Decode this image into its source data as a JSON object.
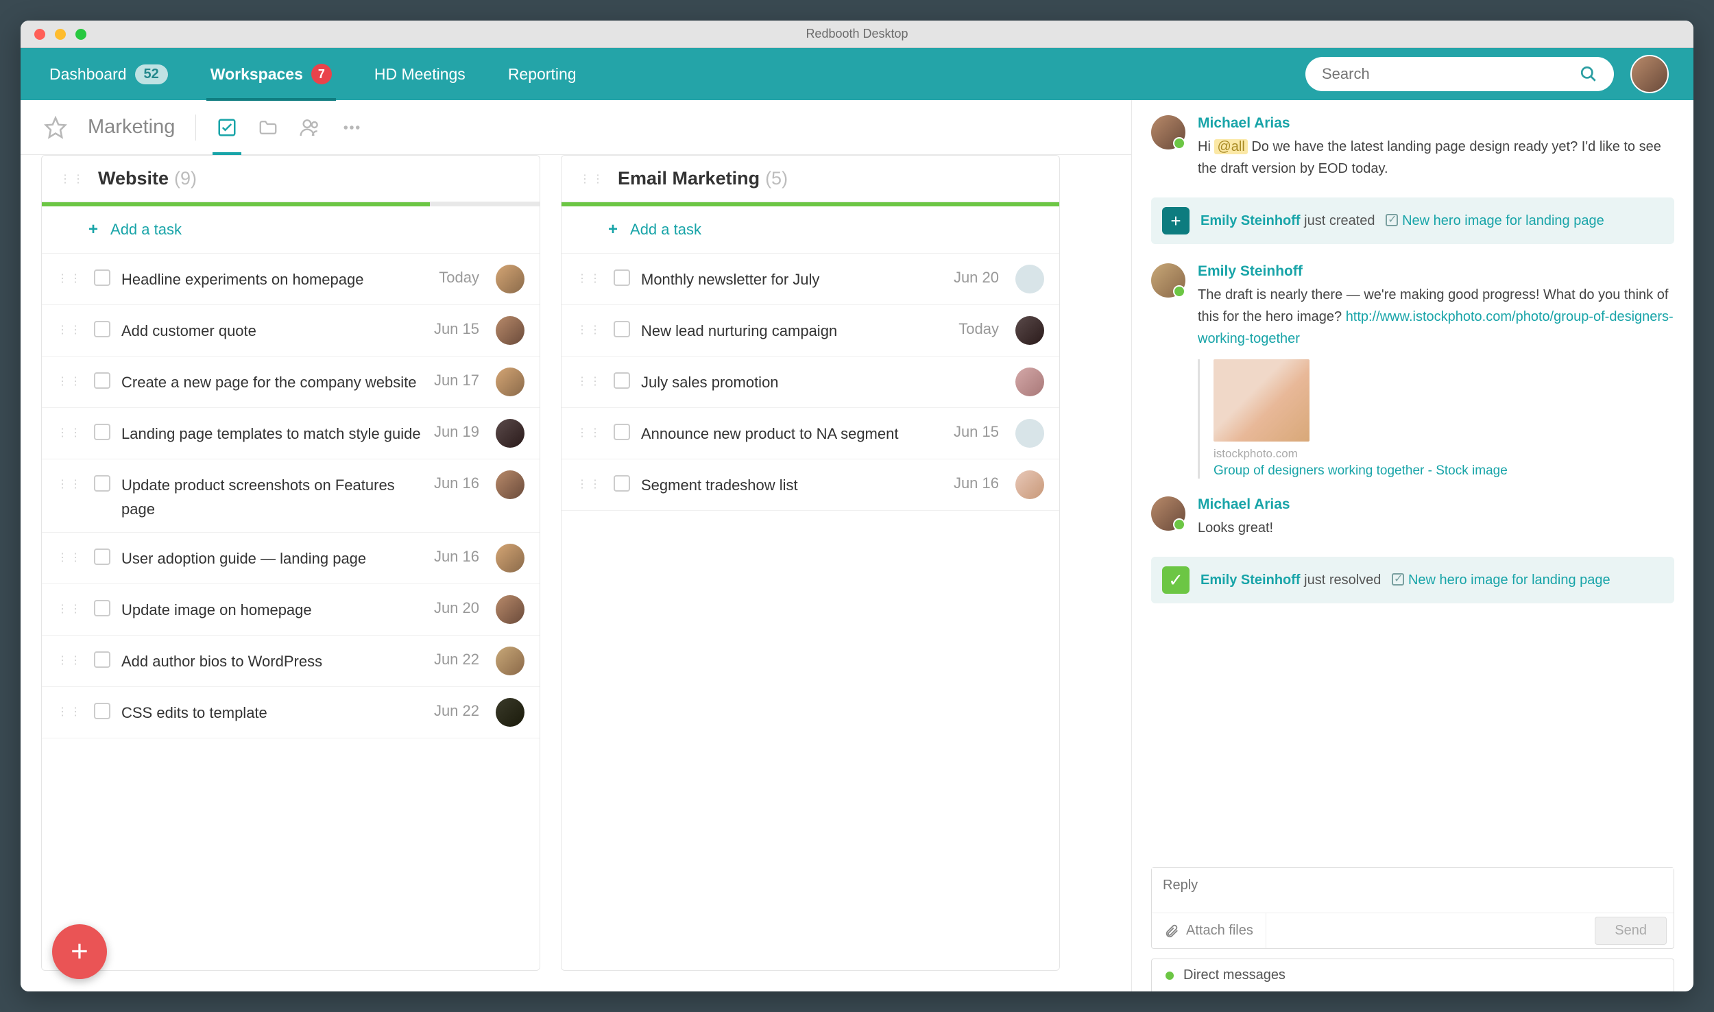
{
  "window_title": "Redbooth Desktop",
  "nav": {
    "dashboard": "Dashboard",
    "dashboard_badge": "52",
    "workspaces": "Workspaces",
    "workspaces_badge": "7",
    "meetings": "HD Meetings",
    "reporting": "Reporting"
  },
  "search_placeholder": "Search",
  "workspace": {
    "name": "Marketing"
  },
  "columns": [
    {
      "title": "Website",
      "count": "(9)",
      "progress": 78,
      "add_label": "Add a task",
      "tasks": [
        {
          "title": "Headline experiments on homepage",
          "date": "Today",
          "avatar": "av1"
        },
        {
          "title": "Add customer quote",
          "date": "Jun 15",
          "avatar": "av2"
        },
        {
          "title": "Create a new page for the company website",
          "date": "Jun 17",
          "avatar": "av1"
        },
        {
          "title": "Landing page templates to match style guide",
          "date": "Jun 19",
          "avatar": "av3"
        },
        {
          "title": "Update product screenshots on Features page",
          "date": "Jun 16",
          "avatar": "av2"
        },
        {
          "title": "User adoption guide — landing page",
          "date": "Jun 16",
          "avatar": "av1"
        },
        {
          "title": "Update image on homepage",
          "date": "Jun 20",
          "avatar": "av2"
        },
        {
          "title": "Add author bios to WordPress",
          "date": "Jun 22",
          "avatar": "av4"
        },
        {
          "title": "CSS edits to template",
          "date": "Jun 22",
          "avatar": "av5"
        }
      ]
    },
    {
      "title": "Email Marketing",
      "count": "(5)",
      "progress": 100,
      "add_label": "Add a task",
      "tasks": [
        {
          "title": "Monthly newsletter for July",
          "date": "Jun 20",
          "avatar": "av8"
        },
        {
          "title": "New lead nurturing campaign",
          "date": "Today",
          "avatar": "av3"
        },
        {
          "title": "July sales promotion",
          "date": "",
          "avatar": "av6"
        },
        {
          "title": "Announce new product to NA segment",
          "date": "Jun 15",
          "avatar": "av8"
        },
        {
          "title": "Segment tradeshow list",
          "date": "Jun 16",
          "avatar": "av7"
        }
      ]
    }
  ],
  "feed": {
    "m1_author": "Michael Arias",
    "m1_text_pre": "Hi ",
    "m1_mention": "@all",
    "m1_text_post": " Do we have the latest landing page design ready yet? I'd like to see the draft version by EOD today.",
    "act1_user": "Emily Steinhoff",
    "act1_verb": " just created",
    "act1_task": "New hero image for landing page",
    "m2_author": "Emily Steinhoff",
    "m2_text": "The draft is nearly there — we're making good progress! What do you think of this for the hero image? ",
    "m2_link": "http://www.istockphoto.com/photo/group-of-designers-working-together",
    "attach_source": "istockphoto.com",
    "attach_title": "Group of designers working together - Stock image",
    "m3_author": "Michael Arias",
    "m3_text": "Looks great!",
    "act2_user": "Emily Steinhoff",
    "act2_verb": " just resolved",
    "act2_task": "New hero image for landing page"
  },
  "reply_placeholder": "Reply",
  "attach_label": "Attach files",
  "send_label": "Send",
  "dm_label": "Direct messages"
}
